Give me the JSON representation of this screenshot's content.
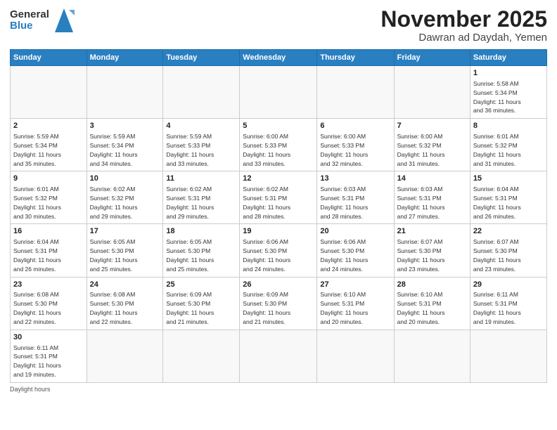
{
  "header": {
    "logo_general": "General",
    "logo_blue": "Blue",
    "month_title": "November 2025",
    "location": "Dawran ad Daydah, Yemen"
  },
  "weekdays": [
    "Sunday",
    "Monday",
    "Tuesday",
    "Wednesday",
    "Thursday",
    "Friday",
    "Saturday"
  ],
  "days": {
    "d1": {
      "num": "1",
      "info": "Sunrise: 5:58 AM\nSunset: 5:34 PM\nDaylight: 11 hours\nand 36 minutes."
    },
    "d2": {
      "num": "2",
      "info": "Sunrise: 5:59 AM\nSunset: 5:34 PM\nDaylight: 11 hours\nand 35 minutes."
    },
    "d3": {
      "num": "3",
      "info": "Sunrise: 5:59 AM\nSunset: 5:34 PM\nDaylight: 11 hours\nand 34 minutes."
    },
    "d4": {
      "num": "4",
      "info": "Sunrise: 5:59 AM\nSunset: 5:33 PM\nDaylight: 11 hours\nand 33 minutes."
    },
    "d5": {
      "num": "5",
      "info": "Sunrise: 6:00 AM\nSunset: 5:33 PM\nDaylight: 11 hours\nand 33 minutes."
    },
    "d6": {
      "num": "6",
      "info": "Sunrise: 6:00 AM\nSunset: 5:33 PM\nDaylight: 11 hours\nand 32 minutes."
    },
    "d7": {
      "num": "7",
      "info": "Sunrise: 6:00 AM\nSunset: 5:32 PM\nDaylight: 11 hours\nand 31 minutes."
    },
    "d8": {
      "num": "8",
      "info": "Sunrise: 6:01 AM\nSunset: 5:32 PM\nDaylight: 11 hours\nand 31 minutes."
    },
    "d9": {
      "num": "9",
      "info": "Sunrise: 6:01 AM\nSunset: 5:32 PM\nDaylight: 11 hours\nand 30 minutes."
    },
    "d10": {
      "num": "10",
      "info": "Sunrise: 6:02 AM\nSunset: 5:32 PM\nDaylight: 11 hours\nand 29 minutes."
    },
    "d11": {
      "num": "11",
      "info": "Sunrise: 6:02 AM\nSunset: 5:31 PM\nDaylight: 11 hours\nand 29 minutes."
    },
    "d12": {
      "num": "12",
      "info": "Sunrise: 6:02 AM\nSunset: 5:31 PM\nDaylight: 11 hours\nand 28 minutes."
    },
    "d13": {
      "num": "13",
      "info": "Sunrise: 6:03 AM\nSunset: 5:31 PM\nDaylight: 11 hours\nand 28 minutes."
    },
    "d14": {
      "num": "14",
      "info": "Sunrise: 6:03 AM\nSunset: 5:31 PM\nDaylight: 11 hours\nand 27 minutes."
    },
    "d15": {
      "num": "15",
      "info": "Sunrise: 6:04 AM\nSunset: 5:31 PM\nDaylight: 11 hours\nand 26 minutes."
    },
    "d16": {
      "num": "16",
      "info": "Sunrise: 6:04 AM\nSunset: 5:31 PM\nDaylight: 11 hours\nand 26 minutes."
    },
    "d17": {
      "num": "17",
      "info": "Sunrise: 6:05 AM\nSunset: 5:30 PM\nDaylight: 11 hours\nand 25 minutes."
    },
    "d18": {
      "num": "18",
      "info": "Sunrise: 6:05 AM\nSunset: 5:30 PM\nDaylight: 11 hours\nand 25 minutes."
    },
    "d19": {
      "num": "19",
      "info": "Sunrise: 6:06 AM\nSunset: 5:30 PM\nDaylight: 11 hours\nand 24 minutes."
    },
    "d20": {
      "num": "20",
      "info": "Sunrise: 6:06 AM\nSunset: 5:30 PM\nDaylight: 11 hours\nand 24 minutes."
    },
    "d21": {
      "num": "21",
      "info": "Sunrise: 6:07 AM\nSunset: 5:30 PM\nDaylight: 11 hours\nand 23 minutes."
    },
    "d22": {
      "num": "22",
      "info": "Sunrise: 6:07 AM\nSunset: 5:30 PM\nDaylight: 11 hours\nand 23 minutes."
    },
    "d23": {
      "num": "23",
      "info": "Sunrise: 6:08 AM\nSunset: 5:30 PM\nDaylight: 11 hours\nand 22 minutes."
    },
    "d24": {
      "num": "24",
      "info": "Sunrise: 6:08 AM\nSunset: 5:30 PM\nDaylight: 11 hours\nand 22 minutes."
    },
    "d25": {
      "num": "25",
      "info": "Sunrise: 6:09 AM\nSunset: 5:30 PM\nDaylight: 11 hours\nand 21 minutes."
    },
    "d26": {
      "num": "26",
      "info": "Sunrise: 6:09 AM\nSunset: 5:30 PM\nDaylight: 11 hours\nand 21 minutes."
    },
    "d27": {
      "num": "27",
      "info": "Sunrise: 6:10 AM\nSunset: 5:31 PM\nDaylight: 11 hours\nand 20 minutes."
    },
    "d28": {
      "num": "28",
      "info": "Sunrise: 6:10 AM\nSunset: 5:31 PM\nDaylight: 11 hours\nand 20 minutes."
    },
    "d29": {
      "num": "29",
      "info": "Sunrise: 6:11 AM\nSunset: 5:31 PM\nDaylight: 11 hours\nand 19 minutes."
    },
    "d30": {
      "num": "30",
      "info": "Sunrise: 6:11 AM\nSunset: 5:31 PM\nDaylight: 11 hours\nand 19 minutes."
    }
  },
  "footer": {
    "daylight_label": "Daylight hours"
  }
}
